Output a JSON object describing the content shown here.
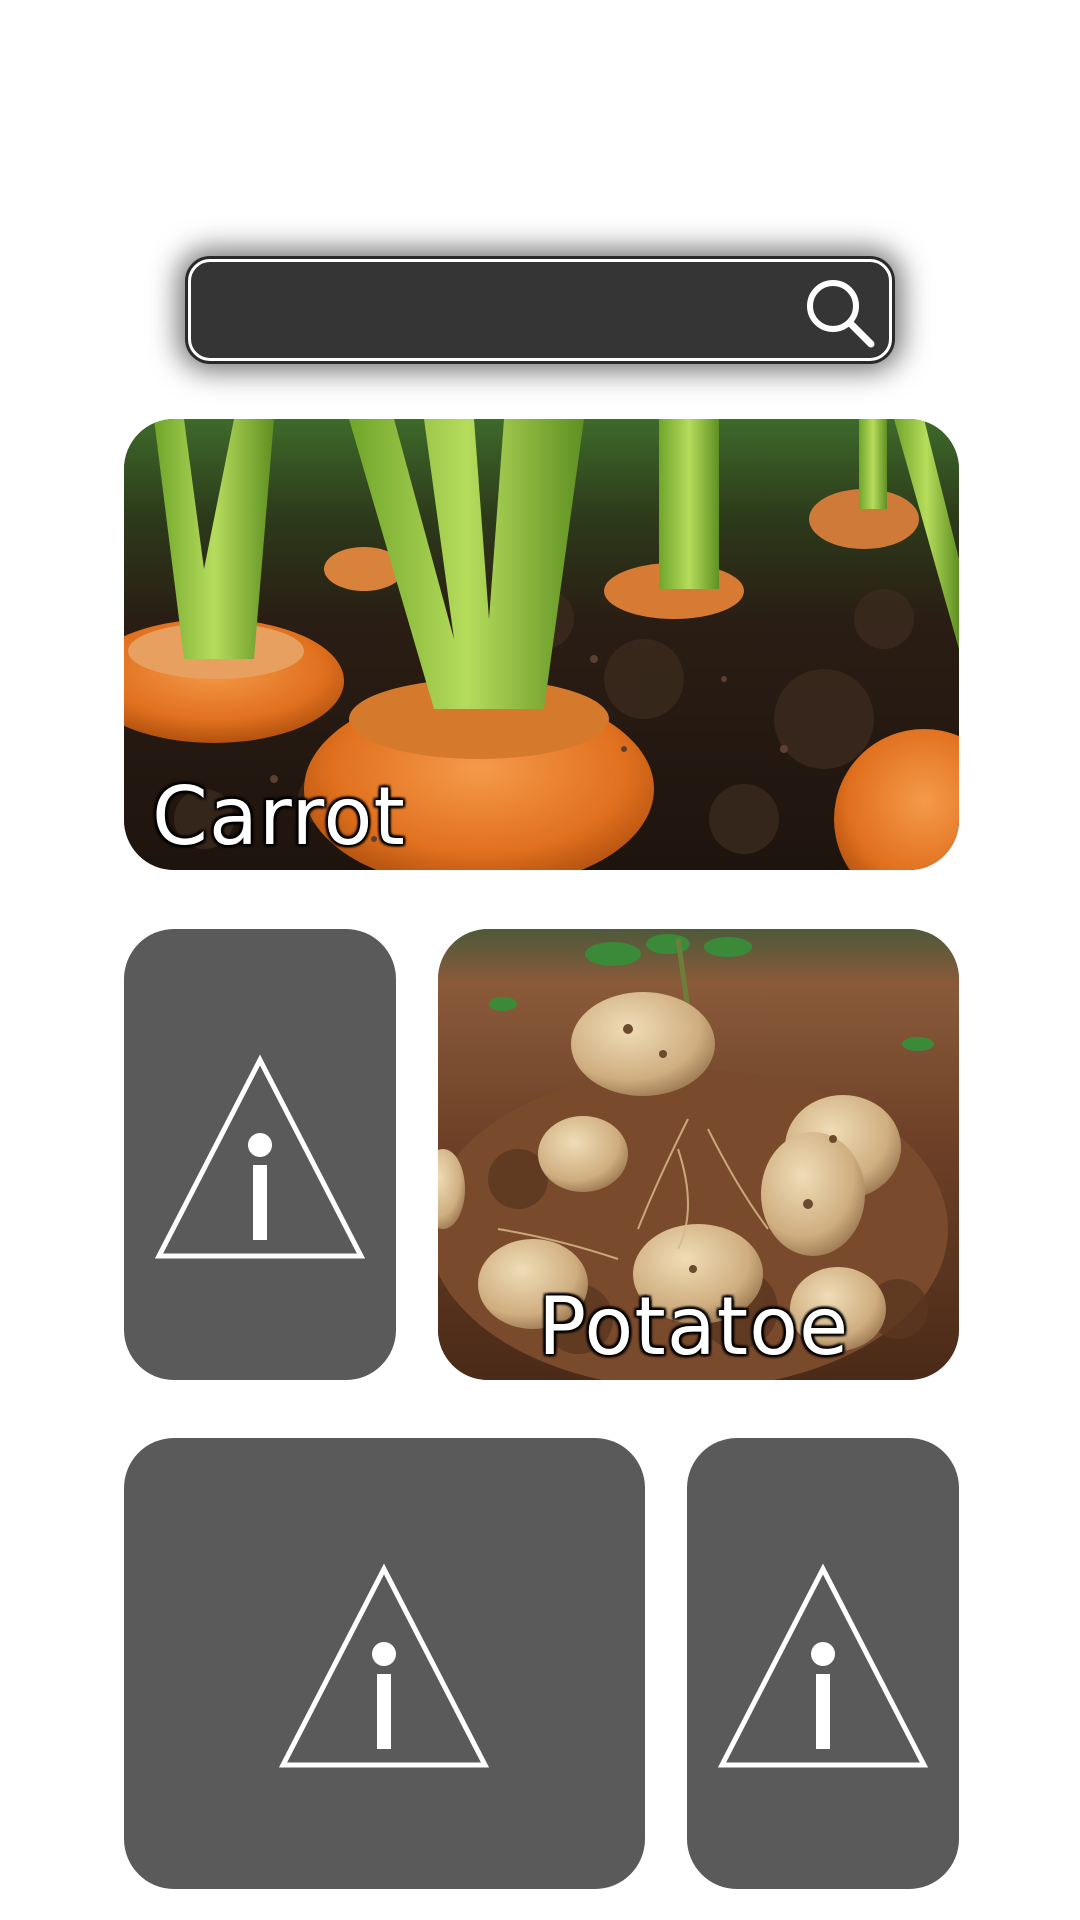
{
  "search": {
    "value": "",
    "placeholder": ""
  },
  "tiles": [
    {
      "label": "Carrot",
      "image": "carrot-photo"
    },
    {
      "label": "",
      "image": "image-missing-icon"
    },
    {
      "label": "Potatoe",
      "image": "potato-photo"
    },
    {
      "label": "",
      "image": "image-missing-icon"
    },
    {
      "label": "",
      "image": "image-missing-icon"
    }
  ],
  "colors": {
    "background": "#ffffff",
    "search_bar": "#353535",
    "placeholder_tile": "#5a5a5a",
    "icon_stroke": "#ffffff"
  }
}
